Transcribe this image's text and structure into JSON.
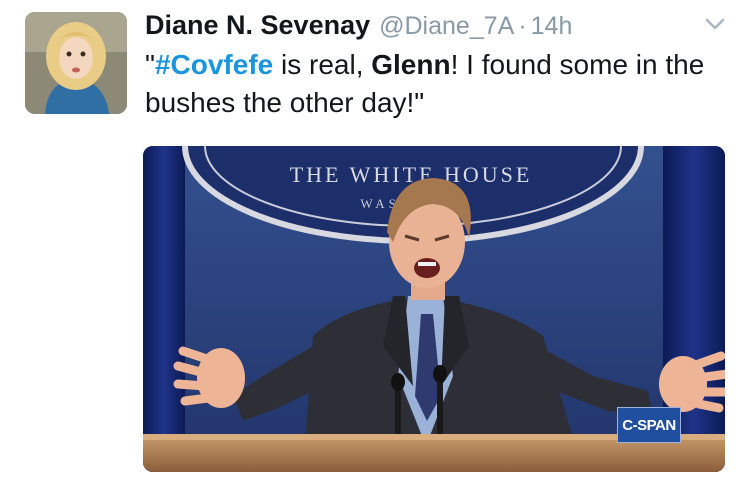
{
  "tweet": {
    "display_name": "Diane N. Sevenay",
    "handle": "@Diane_7A",
    "separator": "·",
    "time": "14h",
    "text": {
      "open_quote": "\"",
      "hashtag": "#Covfefe",
      "part1": " is real, ",
      "bold_word": "Glenn",
      "part2": "! I found some in the bushes the other day!\""
    }
  },
  "media": {
    "seal_text_top": "THE WHITE HOUSE",
    "seal_text_bottom": "WASHI",
    "network_badge": "C-SPAN"
  },
  "icons": {
    "menu": "chevron-down-icon"
  },
  "colors": {
    "hashtag": "#1b95e0",
    "meta_gray": "#8899a6",
    "backdrop_blue": "#2a3a72"
  }
}
